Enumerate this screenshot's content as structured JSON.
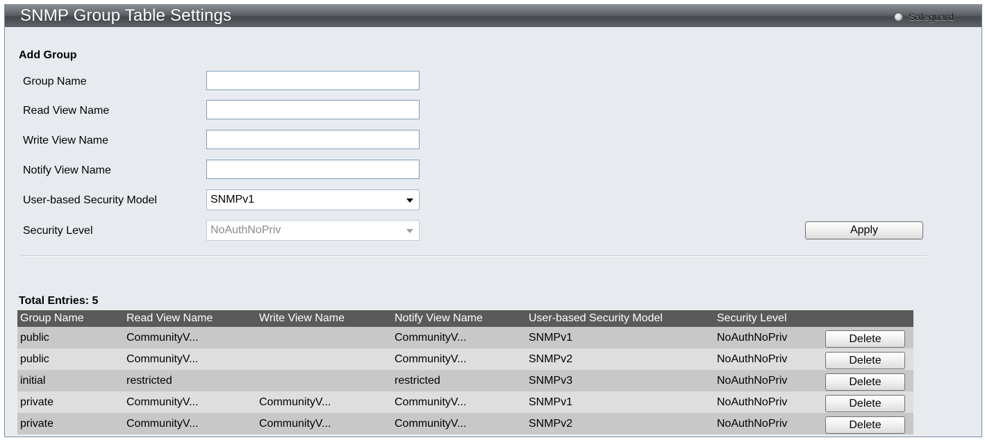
{
  "header": {
    "title": "SNMP Group Table Settings",
    "safeguard_label": "Safeguard"
  },
  "add_group": {
    "section_title": "Add Group",
    "fields": {
      "group_name": {
        "label": "Group Name",
        "value": ""
      },
      "read_view_name": {
        "label": "Read View Name",
        "value": ""
      },
      "write_view_name": {
        "label": "Write View Name",
        "value": ""
      },
      "notify_view_name": {
        "label": "Notify View Name",
        "value": ""
      },
      "security_model": {
        "label": "User-based Security Model",
        "value": "SNMPv1"
      },
      "security_level": {
        "label": "Security Level",
        "value": "NoAuthNoPriv",
        "disabled": true
      }
    },
    "apply_label": "Apply"
  },
  "table": {
    "total_entries": "Total Entries: 5",
    "columns": [
      "Group Name",
      "Read View Name",
      "Write View Name",
      "Notify View Name",
      "User-based Security Model",
      "Security Level"
    ],
    "rows": [
      {
        "group": "public",
        "read": "CommunityV...",
        "write": "",
        "notify": "CommunityV...",
        "model": "SNMPv1",
        "level": "NoAuthNoPriv",
        "action": "Delete"
      },
      {
        "group": "public",
        "read": "CommunityV...",
        "write": "",
        "notify": "CommunityV...",
        "model": "SNMPv2",
        "level": "NoAuthNoPriv",
        "action": "Delete"
      },
      {
        "group": "initial",
        "read": "restricted",
        "write": "",
        "notify": "restricted",
        "model": "SNMPv3",
        "level": "NoAuthNoPriv",
        "action": "Delete"
      },
      {
        "group": "private",
        "read": "CommunityV...",
        "write": "CommunityV...",
        "notify": "CommunityV...",
        "model": "SNMPv1",
        "level": "NoAuthNoPriv",
        "action": "Delete"
      },
      {
        "group": "private",
        "read": "CommunityV...",
        "write": "CommunityV...",
        "notify": "CommunityV...",
        "model": "SNMPv2",
        "level": "NoAuthNoPriv",
        "action": "Delete"
      }
    ]
  }
}
